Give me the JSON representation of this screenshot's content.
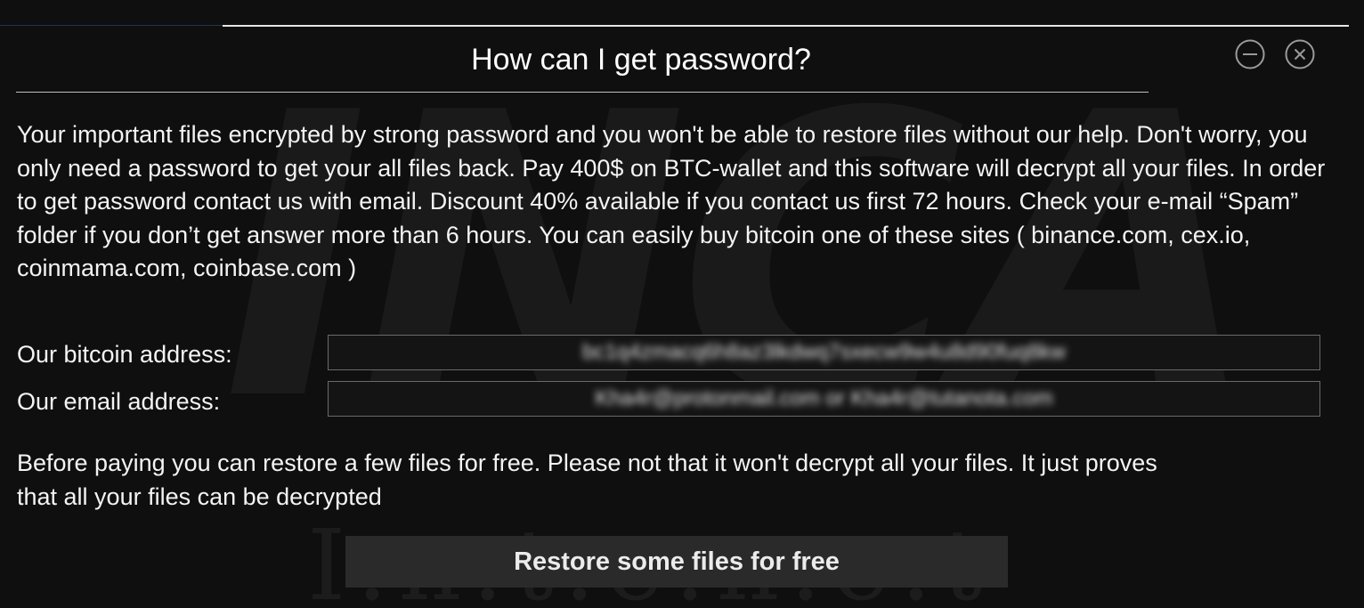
{
  "watermark": {
    "logo_text": "INCA",
    "sub_text": "I.n.t.e.n.e.t"
  },
  "window": {
    "title": "How can I get password?",
    "minimize_icon": "minimize-circle-icon",
    "close_icon": "close-circle-icon"
  },
  "message": {
    "body": "Your important files encrypted by strong password and you won't be able to restore files without our help. Don't worry, you only need a password to get your all files back. Pay 400$ on BTC-wallet and this software will decrypt all your files. In order to get password contact us with email. Discount 40% available if you contact us first 72 hours. Check your e-mail “Spam” folder if you don’t get answer more than 6 hours. You can easily buy bitcoin one of these sites ( binance.com, cex.io, coinmama.com, coinbase.com )"
  },
  "fields": {
    "bitcoin_label": "Our bitcoin address:",
    "bitcoin_value": "bc1q4zmacq6h8az3lkdwq7sxecw9w4u8d90fuq8kw",
    "email_label": "Our email address:",
    "email_value": "Kha4r@protonmail.com  or  Kha4r@tutanota.com"
  },
  "note": {
    "text": "Before paying you can restore a few files for free. Please not that it won't decrypt all your files. It just proves that all your files can be decrypted"
  },
  "actions": {
    "restore_label": "Restore some files for free"
  },
  "colors": {
    "background": "#0f0f0f",
    "text": "#f4f4f4",
    "button_bg": "#2a2a2a",
    "field_border": "#6a6a6a",
    "accent_line": "#1f3550"
  }
}
